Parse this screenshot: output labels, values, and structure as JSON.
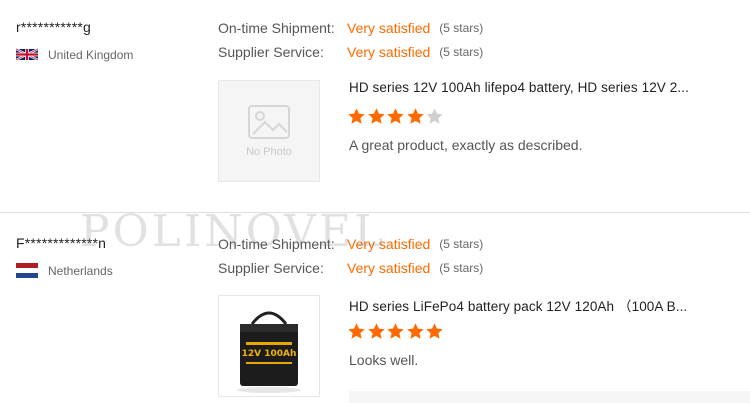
{
  "reviews": [
    {
      "username": "r***********g",
      "country": "United Kingdom",
      "flag": "uk",
      "shipment_label": "On-time Shipment:",
      "shipment_value": "Very satisfied",
      "shipment_stars": "(5 stars)",
      "service_label": "Supplier Service:",
      "service_value": "Very satisfied",
      "service_stars": "(5 stars)",
      "image_placeholder": "No Photo",
      "product_title": "HD series 12V 100Ah lifepo4 battery, HD series 12V 2...",
      "rating": 4,
      "rating_max": 5,
      "comment": "A great product, exactly as described."
    },
    {
      "username": "F*************n",
      "country": "Netherlands",
      "flag": "nl",
      "shipment_label": "On-time Shipment:",
      "shipment_value": "Very satisfied",
      "shipment_stars": "(5 stars)",
      "service_label": "Supplier Service:",
      "service_value": "Very satisfied",
      "service_stars": "(5 stars)",
      "image_label": "12V 100Ah",
      "product_title": "HD series LiFePo4 battery pack 12V 120Ah （100A B...",
      "rating": 5,
      "rating_max": 5,
      "comment": "Looks well."
    }
  ],
  "watermark": "POLINOVEL",
  "colors": {
    "accent": "#ff6a00",
    "star_on": "#ff6a00",
    "star_off": "#d0d0d0"
  }
}
